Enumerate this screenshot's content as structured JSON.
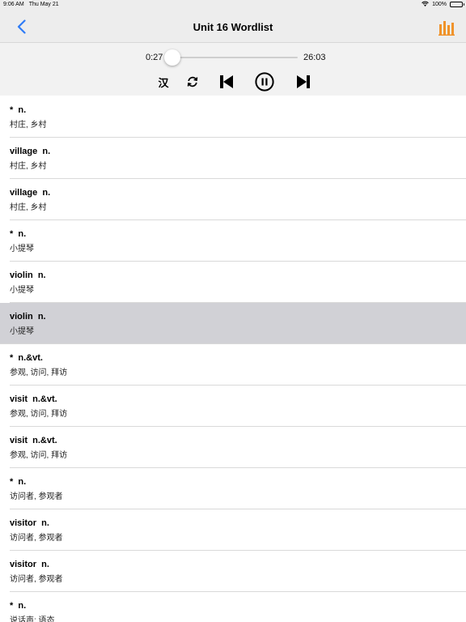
{
  "status_bar": {
    "time": "9:06 AM",
    "date": "Thu May 21",
    "battery": "100%"
  },
  "nav": {
    "title": "Unit 16 Wordlist",
    "accent_color": "#2f7cf6",
    "chart_icon_color": "#f0932b"
  },
  "player": {
    "current_time": "0:27",
    "total_time": "26:03",
    "progress_fraction": 0.017,
    "language_label": "汉",
    "icons": [
      "repeat-icon",
      "previous-track-icon",
      "pause-icon",
      "next-track-icon"
    ]
  },
  "words": [
    {
      "word": "*  n.",
      "meaning": "村庄, 乡村",
      "selected": false
    },
    {
      "word": "village  n.",
      "meaning": "村庄, 乡村",
      "selected": false
    },
    {
      "word": "village  n.",
      "meaning": "村庄, 乡村",
      "selected": false
    },
    {
      "word": "*  n.",
      "meaning": "小提琴",
      "selected": false
    },
    {
      "word": "violin  n.",
      "meaning": "小提琴",
      "selected": false
    },
    {
      "word": "violin  n.",
      "meaning": "小提琴",
      "selected": true
    },
    {
      "word": "*  n.&vt.",
      "meaning": "参观, 访问, 拜访",
      "selected": false
    },
    {
      "word": "visit  n.&vt.",
      "meaning": "参观, 访问, 拜访",
      "selected": false
    },
    {
      "word": "visit  n.&vt.",
      "meaning": "参观, 访问, 拜访",
      "selected": false
    },
    {
      "word": "*  n.",
      "meaning": "访问者, 参观者",
      "selected": false
    },
    {
      "word": "visitor  n.",
      "meaning": "访问者, 参观者",
      "selected": false
    },
    {
      "word": "visitor  n.",
      "meaning": "访问者, 参观者",
      "selected": false
    },
    {
      "word": "*  n.",
      "meaning": "说话声; 语态",
      "selected": false
    }
  ]
}
